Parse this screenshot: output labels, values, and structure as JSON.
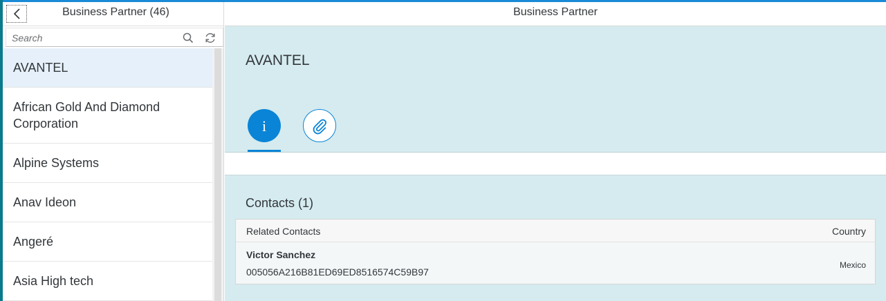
{
  "master": {
    "title": "Business Partner (46)",
    "search": {
      "placeholder": "Search",
      "value": ""
    },
    "items": [
      {
        "label": "AVANTEL"
      },
      {
        "label": "African Gold And Diamond Corporation"
      },
      {
        "label": "Alpine Systems"
      },
      {
        "label": "Anav Ideon"
      },
      {
        "label": "Angeré"
      },
      {
        "label": "Asia High tech"
      }
    ]
  },
  "detail": {
    "header_title": "Business Partner",
    "object_title": "AVANTEL",
    "tabs": [
      {
        "icon": "info-icon"
      },
      {
        "icon": "paperclip-icon"
      }
    ],
    "contacts": {
      "section_title": "Contacts (1)",
      "columns": [
        "Related Contacts",
        "Country"
      ],
      "rows": [
        {
          "name": "Victor Sanchez",
          "id": "005056A216B81ED69ED8516574C59B97",
          "country": "Mexico"
        }
      ]
    }
  },
  "colors": {
    "accent": "#0a84d6",
    "detail_background": "#d5ebef",
    "selected_item": "#e5f0fa",
    "shell_accent": "#0a7b8c"
  }
}
